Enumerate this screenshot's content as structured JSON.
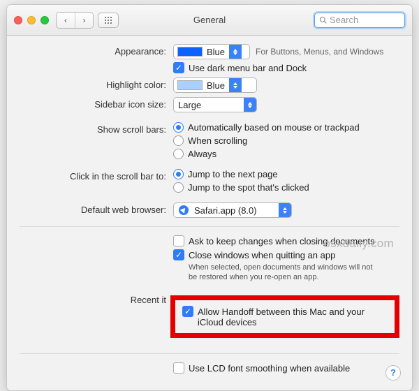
{
  "window": {
    "title": "General"
  },
  "search": {
    "placeholder": "Search"
  },
  "appearance": {
    "label": "Appearance:",
    "value": "Blue",
    "hint": "For Buttons, Menus, and Windows",
    "dark_label": "Use dark menu bar and Dock",
    "dark_checked": true
  },
  "highlight": {
    "label": "Highlight color:",
    "value": "Blue"
  },
  "sidebar": {
    "label": "Sidebar icon size:",
    "value": "Large"
  },
  "scrollbars": {
    "label": "Show scroll bars:",
    "options": {
      "auto": "Automatically based on mouse or trackpad",
      "scrolling": "When scrolling",
      "always": "Always"
    },
    "selected": "auto"
  },
  "click": {
    "label": "Click in the scroll bar to:",
    "options": {
      "page": "Jump to the next page",
      "spot": "Jump to the spot that's clicked"
    },
    "selected": "page"
  },
  "browser": {
    "label": "Default web browser:",
    "value": "Safari.app (8.0)"
  },
  "closing": {
    "ask_label": "Ask to keep changes when closing documents",
    "ask_checked": false,
    "close_label": "Close windows when quitting an app",
    "close_checked": true,
    "close_note": "When selected, open documents and windows will not be restored when you re-open an app."
  },
  "recent": {
    "label": "Recent it"
  },
  "handoff": {
    "label": "Allow Handoff between this Mac and your iCloud devices",
    "checked": true
  },
  "lcd": {
    "label": "Use LCD font smoothing when available",
    "checked": false
  },
  "watermark": "osxdaily.com",
  "help": "?"
}
